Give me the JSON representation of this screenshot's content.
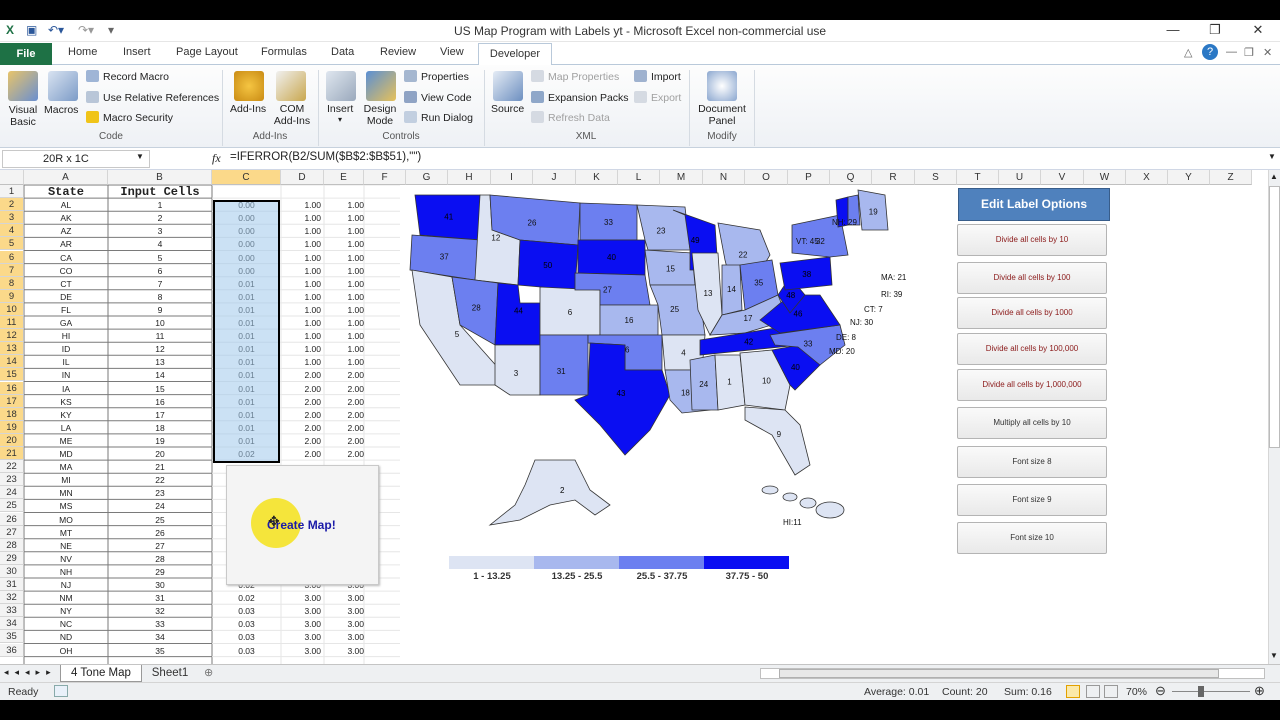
{
  "window": {
    "title": "US Map Program with Labels yt  -  Microsoft Excel non-commercial use",
    "minimize": "—",
    "restore": "❐",
    "close": "✕"
  },
  "tabs": [
    "File",
    "Home",
    "Insert",
    "Page Layout",
    "Formulas",
    "Data",
    "Review",
    "View",
    "Developer"
  ],
  "ribbon": {
    "code_group": {
      "visual_basic": "Visual Basic",
      "macros": "Macros",
      "record_macro": "Record Macro",
      "relative_refs": "Use Relative References",
      "macro_security": "Macro Security",
      "label": "Code"
    },
    "addins_group": {
      "addins": "Add-Ins",
      "com_addins": "COM Add-Ins",
      "label": "Add-Ins"
    },
    "controls_group": {
      "insert": "Insert",
      "design_mode": "Design Mode",
      "properties": "Properties",
      "view_code": "View Code",
      "run_dialog": "Run Dialog",
      "label": "Controls"
    },
    "xml_group": {
      "source": "Source",
      "map_properties": "Map Properties",
      "expansion_packs": "Expansion Packs",
      "refresh_data": "Refresh Data",
      "import": "Import",
      "export": "Export",
      "label": "XML"
    },
    "modify_group": {
      "document_panel": "Document Panel",
      "label": "Modify"
    }
  },
  "formula_bar": {
    "name_box": "20R x 1C",
    "fx": "fx",
    "formula": "=IFERROR(B2/SUM($B$2:$B$51),\"\")"
  },
  "columns": [
    "A",
    "B",
    "C",
    "D",
    "E",
    "F",
    "G",
    "H",
    "I",
    "J",
    "K",
    "L",
    "M",
    "N",
    "O",
    "P",
    "Q",
    "R",
    "S",
    "T",
    "U",
    "V",
    "W",
    "X",
    "Y",
    "Z"
  ],
  "headers": {
    "state": "State",
    "input": "Input Cells"
  },
  "rows": [
    {
      "n": "1"
    },
    {
      "n": "2",
      "a": "AL",
      "b": "1",
      "c": "0.00",
      "d": "1.00",
      "e": "1.00"
    },
    {
      "n": "3",
      "a": "AK",
      "b": "2",
      "c": "0.00",
      "d": "1.00",
      "e": "1.00"
    },
    {
      "n": "4",
      "a": "AZ",
      "b": "3",
      "c": "0.00",
      "d": "1.00",
      "e": "1.00"
    },
    {
      "n": "5",
      "a": "AR",
      "b": "4",
      "c": "0.00",
      "d": "1.00",
      "e": "1.00"
    },
    {
      "n": "6",
      "a": "CA",
      "b": "5",
      "c": "0.00",
      "d": "1.00",
      "e": "1.00"
    },
    {
      "n": "7",
      "a": "CO",
      "b": "6",
      "c": "0.00",
      "d": "1.00",
      "e": "1.00"
    },
    {
      "n": "8",
      "a": "CT",
      "b": "7",
      "c": "0.01",
      "d": "1.00",
      "e": "1.00"
    },
    {
      "n": "9",
      "a": "DE",
      "b": "8",
      "c": "0.01",
      "d": "1.00",
      "e": "1.00"
    },
    {
      "n": "10",
      "a": "FL",
      "b": "9",
      "c": "0.01",
      "d": "1.00",
      "e": "1.00"
    },
    {
      "n": "11",
      "a": "GA",
      "b": "10",
      "c": "0.01",
      "d": "1.00",
      "e": "1.00"
    },
    {
      "n": "12",
      "a": "HI",
      "b": "11",
      "c": "0.01",
      "d": "1.00",
      "e": "1.00"
    },
    {
      "n": "13",
      "a": "ID",
      "b": "12",
      "c": "0.01",
      "d": "1.00",
      "e": "1.00"
    },
    {
      "n": "14",
      "a": "IL",
      "b": "13",
      "c": "0.01",
      "d": "1.00",
      "e": "1.00"
    },
    {
      "n": "15",
      "a": "IN",
      "b": "14",
      "c": "0.01",
      "d": "2.00",
      "e": "2.00"
    },
    {
      "n": "16",
      "a": "IA",
      "b": "15",
      "c": "0.01",
      "d": "2.00",
      "e": "2.00"
    },
    {
      "n": "17",
      "a": "KS",
      "b": "16",
      "c": "0.01",
      "d": "2.00",
      "e": "2.00"
    },
    {
      "n": "18",
      "a": "KY",
      "b": "17",
      "c": "0.01",
      "d": "2.00",
      "e": "2.00"
    },
    {
      "n": "19",
      "a": "LA",
      "b": "18",
      "c": "0.01",
      "d": "2.00",
      "e": "2.00"
    },
    {
      "n": "20",
      "a": "ME",
      "b": "19",
      "c": "0.01",
      "d": "2.00",
      "e": "2.00"
    },
    {
      "n": "21",
      "a": "MD",
      "b": "20",
      "c": "0.02",
      "d": "2.00",
      "e": "2.00"
    },
    {
      "n": "22",
      "a": "MA",
      "b": "21"
    },
    {
      "n": "23",
      "a": "MI",
      "b": "22"
    },
    {
      "n": "24",
      "a": "MN",
      "b": "23"
    },
    {
      "n": "25",
      "a": "MS",
      "b": "24"
    },
    {
      "n": "26",
      "a": "MO",
      "b": "25"
    },
    {
      "n": "27",
      "a": "MT",
      "b": "26"
    },
    {
      "n": "28",
      "a": "NE",
      "b": "27"
    },
    {
      "n": "29",
      "a": "NV",
      "b": "28"
    },
    {
      "n": "30",
      "a": "NH",
      "b": "29"
    },
    {
      "n": "31",
      "a": "NJ",
      "b": "30",
      "c": "0.02",
      "d": "3.00",
      "e": "3.00"
    },
    {
      "n": "32",
      "a": "NM",
      "b": "31",
      "c": "0.02",
      "d": "3.00",
      "e": "3.00"
    },
    {
      "n": "33",
      "a": "NY",
      "b": "32",
      "c": "0.03",
      "d": "3.00",
      "e": "3.00"
    },
    {
      "n": "34",
      "a": "NC",
      "b": "33",
      "c": "0.03",
      "d": "3.00",
      "e": "3.00"
    },
    {
      "n": "35",
      "a": "ND",
      "b": "34",
      "c": "0.03",
      "d": "3.00",
      "e": "3.00"
    },
    {
      "n": "36",
      "a": "OH",
      "b": "35",
      "c": "0.03",
      "d": "3.00",
      "e": "3.00"
    }
  ],
  "create_map_button": "Create Map!",
  "label_options": {
    "header": "Edit Label Options",
    "buttons": [
      "Divide all cells by 10",
      "Divide all cells by 100",
      "Divide all cells by 1000",
      "Divide all cells by 100,000",
      "Divide all cells by 1,000,000",
      "Multiply all cells by 10",
      "Font size 8",
      "Font size 9",
      "Font size 10"
    ]
  },
  "map": {
    "state_values": {
      "WA": "41",
      "OR": "37",
      "CA": "5",
      "ID": "12",
      "NV": "28",
      "MT": "26",
      "WY": "50",
      "UT": "44",
      "AZ": "3",
      "CO": "6",
      "NM": "31",
      "ND": "33",
      "SD": "40",
      "NE": "27",
      "KS": "16",
      "OK": "36",
      "TX": "43",
      "MN": "23",
      "IA": "15",
      "MO": "25",
      "AR": "4",
      "LA": "18",
      "WI": "49",
      "IL": "13",
      "MI": "22",
      "IN": "14",
      "OH": "35",
      "KY": "17",
      "TN": "42",
      "MS": "24",
      "AL": "1",
      "GA": "10",
      "FL": "9",
      "SC": "40",
      "NC": "33",
      "VA": "46",
      "WV": "48",
      "PA": "38",
      "NY": "32",
      "VT": "45",
      "NH": "29",
      "ME": "19",
      "AK": "2"
    },
    "callouts": [
      "NH: 29",
      "VT: 45",
      "MA:  21",
      "RI: 39",
      "CT: 7",
      "NJ: 30",
      "DE:  8",
      "MD:  20",
      "HI:11"
    ],
    "legend": [
      {
        "label": "1 - 13.25",
        "color": "#dde4f3"
      },
      {
        "label": "13.25 - 25.5",
        "color": "#a8b8ee"
      },
      {
        "label": "25.5 - 37.75",
        "color": "#6c7ff0"
      },
      {
        "label": "37.75 - 50",
        "color": "#0a0ef2"
      }
    ]
  },
  "sheets": [
    "4 Tone Map",
    "Sheet1"
  ],
  "status": {
    "ready": "Ready",
    "average": "Average: 0.01",
    "count": "Count: 20",
    "sum": "Sum: 0.16",
    "zoom": "70%"
  }
}
